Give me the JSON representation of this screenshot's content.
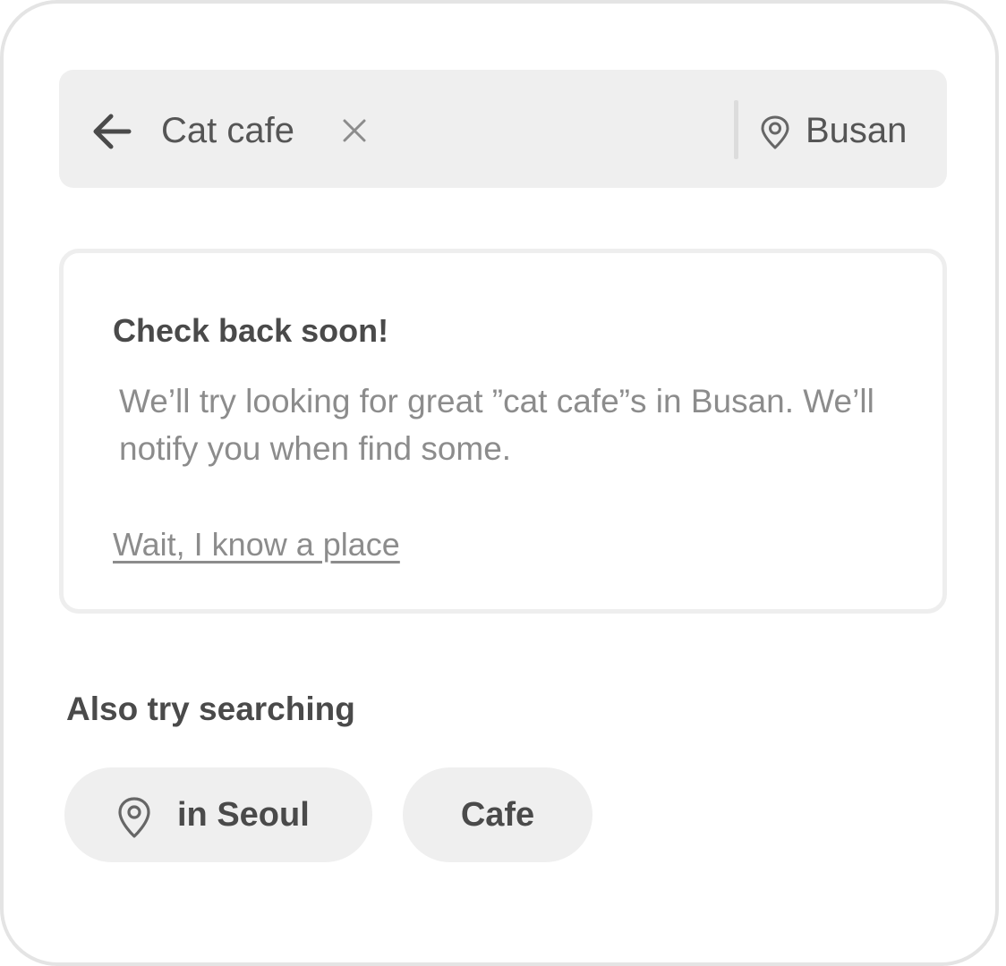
{
  "search": {
    "query": "Cat cafe",
    "location": "Busan"
  },
  "icons": {
    "back": "arrow-left-icon",
    "clear": "close-icon",
    "location": "map-pin-icon"
  },
  "notice": {
    "title": "Check back soon!",
    "body": "We’ll try looking for great ”cat cafe”s in Busan. We’ll notify you when find some.",
    "link_label": "Wait, I know a place"
  },
  "suggestions": {
    "title": "Also try searching",
    "chips": [
      {
        "label": "in Seoul",
        "icon": "map-pin-icon"
      },
      {
        "label": "Cafe"
      }
    ]
  },
  "colors": {
    "search_bar_bg": "#efefef",
    "chip_bg": "#efefef",
    "card_border": "#eeeeee",
    "frame_border": "#e4e4e4",
    "primary_text": "#4a4a4a",
    "secondary_text": "#8c8c8c"
  }
}
